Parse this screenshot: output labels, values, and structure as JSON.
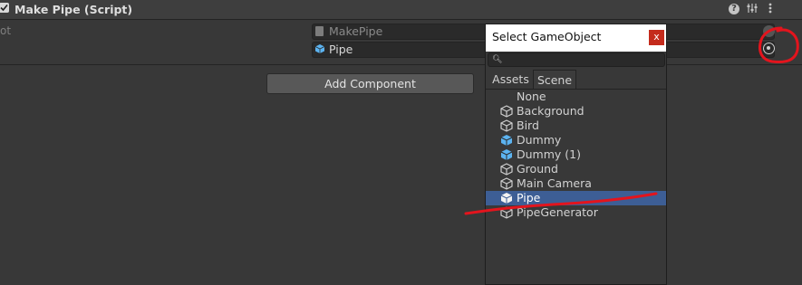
{
  "component": {
    "title": "Make Pipe (Script)",
    "label_fragment": "ot"
  },
  "fields": {
    "script_value": "MakePipe",
    "pipe_value": "Pipe"
  },
  "add_component_label": "Add Component",
  "picker": {
    "title": "Select GameObject",
    "close_label": "x",
    "search_placeholder": "",
    "tabs": [
      {
        "label": "Assets",
        "active": false
      },
      {
        "label": "Scene",
        "active": true
      }
    ],
    "items": [
      {
        "label": "None",
        "icon": "none"
      },
      {
        "label": "Background",
        "icon": "gameobject-outline"
      },
      {
        "label": "Bird",
        "icon": "gameobject-outline"
      },
      {
        "label": "Dummy",
        "icon": "prefab-blue"
      },
      {
        "label": "Dummy (1)",
        "icon": "prefab-blue"
      },
      {
        "label": "Ground",
        "icon": "gameobject-outline"
      },
      {
        "label": "Main Camera",
        "icon": "gameobject-outline"
      },
      {
        "label": "Pipe",
        "icon": "prefab-white",
        "selected": true
      },
      {
        "label": "PipeGenerator",
        "icon": "gameobject-outline"
      }
    ]
  },
  "colors": {
    "selection": "#3d5e95",
    "annotation": "#e3141d",
    "prefab": "#5cb3f0"
  }
}
